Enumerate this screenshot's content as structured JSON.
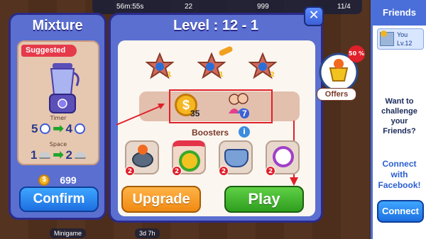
{
  "topbar": {
    "timer": "56m:55s",
    "hearts": "22",
    "coins": "999",
    "progress": "11/4"
  },
  "mixture": {
    "title": "Mixture",
    "suggested": "Suggested",
    "timer_label": "Timer",
    "timer_from": "5",
    "timer_to": "4",
    "space_label": "Space",
    "space_from": "1",
    "space_to": "2",
    "price": "699",
    "confirm": "Confirm"
  },
  "level": {
    "title": "Level : 12 - 1",
    "stars": [
      "1",
      "1",
      "2"
    ],
    "goal_coins": "35",
    "goal_customers": "7",
    "boosters_label": "Boosters",
    "booster_counts": [
      "2",
      "2",
      "2",
      "2"
    ],
    "upgrade": "Upgrade",
    "play": "Play"
  },
  "offers": {
    "label": "Offers",
    "tag": "50 %"
  },
  "friends": {
    "title": "Friends",
    "friend_name": "You",
    "friend_level": "Lv.12",
    "challenge": "Want to challenge your Friends?",
    "connect_text": "Connect with Facebook!",
    "connect_button": "Connect"
  },
  "bottom": {
    "minigame": "Minigame",
    "timer": "3d 7h"
  },
  "colors": {
    "panel": "#5a6fd0",
    "panel_border": "#2b2a8a",
    "play": "#2e9e1e",
    "upgrade": "#f08a12",
    "confirm": "#1e6fe0",
    "highlight": "#e0202a"
  }
}
